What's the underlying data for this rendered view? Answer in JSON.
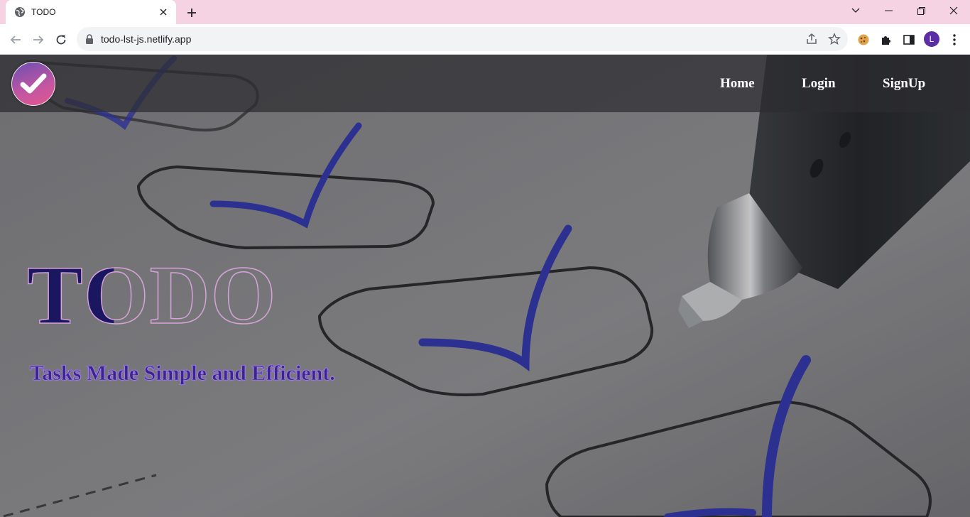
{
  "browser": {
    "tab_title": "TODO",
    "url": "todo-lst-js.netlify.app",
    "profile_initial": "L"
  },
  "navbar": {
    "links": [
      {
        "label": "Home"
      },
      {
        "label": "Login"
      },
      {
        "label": "SignUp"
      }
    ]
  },
  "hero": {
    "title": "TODO",
    "tagline": "Tasks Made Simple and Efficient."
  },
  "colors": {
    "tabstrip": "#f6d3e3",
    "title_fill": "#1b1660",
    "title_stroke": "#d6a3d8",
    "tagline": "#3a2490"
  },
  "icons": [
    "globe-icon",
    "close-icon",
    "plus-icon",
    "back-icon",
    "forward-icon",
    "reload-icon",
    "lock-icon",
    "share-icon",
    "star-icon",
    "cookie-icon",
    "puzzle-icon",
    "side-panel-icon",
    "kebab-menu-icon",
    "checkmark-icon"
  ]
}
